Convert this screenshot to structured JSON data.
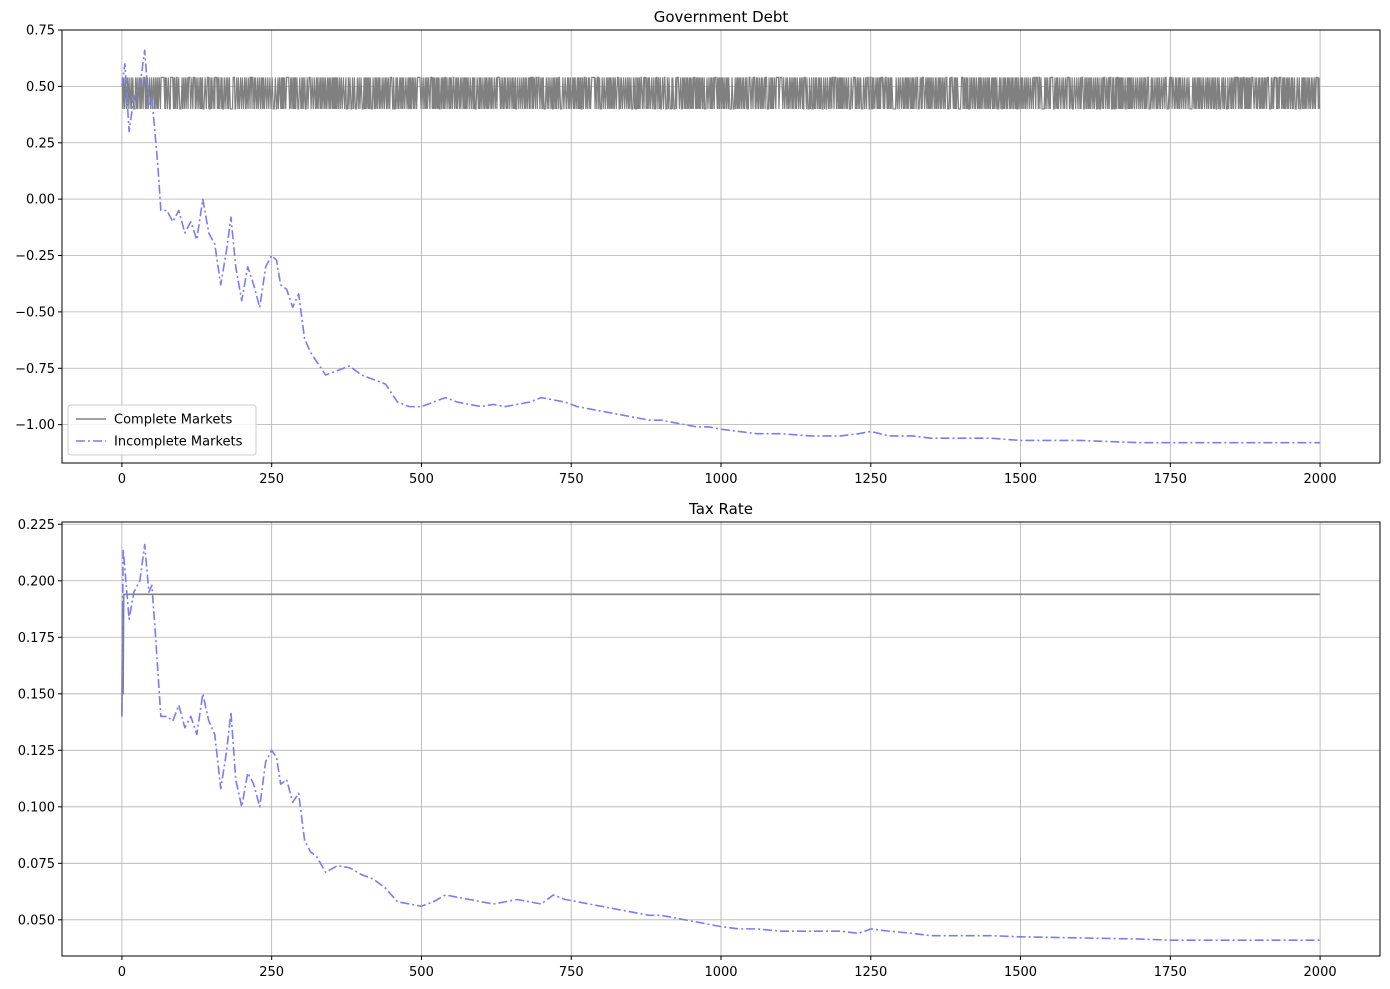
{
  "chart_data": [
    {
      "type": "line",
      "title": "Government Debt",
      "xlabel": "",
      "ylabel": "",
      "xlim": [
        -100,
        2100
      ],
      "ylim": [
        -1.17,
        0.75
      ],
      "xticks": [
        0,
        250,
        500,
        750,
        1000,
        1250,
        1500,
        1750,
        2000
      ],
      "xtick_labels": [
        "0",
        "250",
        "500",
        "750",
        "1000",
        "1250",
        "1500",
        "1750",
        "2000"
      ],
      "yticks": [
        0.75,
        0.5,
        0.25,
        0.0,
        -0.25,
        -0.5,
        -0.75,
        -1.0
      ],
      "ytick_labels": [
        "0.75",
        "0.50",
        "0.25",
        "0.00",
        "−0.25",
        "−0.50",
        "−0.75",
        "−1.00"
      ],
      "grid": true,
      "legend": "lower-left",
      "series": [
        {
          "name": "Complete Markets",
          "color": "#808080",
          "style": "solid",
          "oscillation": {
            "x_start": 0,
            "x_end": 2000,
            "high": 0.54,
            "low": 0.4
          },
          "x": [
            0,
            2000
          ],
          "y": [
            0.5,
            0.5
          ]
        },
        {
          "name": "Incomplete Markets",
          "color": "#7b7bf5",
          "style": "dashdot",
          "x": [
            0,
            5,
            12,
            20,
            30,
            38,
            45,
            50,
            55,
            60,
            65,
            75,
            85,
            95,
            105,
            115,
            125,
            135,
            145,
            155,
            165,
            175,
            182,
            190,
            200,
            210,
            220,
            230,
            240,
            250,
            258,
            265,
            275,
            285,
            295,
            305,
            315,
            325,
            340,
            360,
            380,
            400,
            420,
            440,
            460,
            480,
            500,
            520,
            540,
            560,
            580,
            600,
            620,
            640,
            660,
            680,
            700,
            720,
            740,
            760,
            780,
            800,
            820,
            840,
            860,
            880,
            900,
            920,
            940,
            960,
            980,
            1000,
            1030,
            1060,
            1100,
            1150,
            1200,
            1230,
            1250,
            1280,
            1320,
            1350,
            1400,
            1450,
            1500,
            1600,
            1700,
            1750,
            1800,
            1900,
            2000
          ],
          "y": [
            0.5,
            0.6,
            0.3,
            0.45,
            0.5,
            0.66,
            0.42,
            0.45,
            0.3,
            0.15,
            -0.05,
            -0.05,
            -0.1,
            -0.05,
            -0.15,
            -0.1,
            -0.18,
            0.0,
            -0.15,
            -0.2,
            -0.38,
            -0.22,
            -0.08,
            -0.3,
            -0.45,
            -0.3,
            -0.38,
            -0.48,
            -0.3,
            -0.25,
            -0.27,
            -0.38,
            -0.4,
            -0.48,
            -0.42,
            -0.62,
            -0.68,
            -0.72,
            -0.78,
            -0.76,
            -0.74,
            -0.78,
            -0.8,
            -0.82,
            -0.9,
            -0.92,
            -0.92,
            -0.9,
            -0.88,
            -0.9,
            -0.91,
            -0.92,
            -0.91,
            -0.92,
            -0.91,
            -0.9,
            -0.88,
            -0.89,
            -0.9,
            -0.92,
            -0.93,
            -0.94,
            -0.95,
            -0.96,
            -0.97,
            -0.98,
            -0.98,
            -0.99,
            -1.0,
            -1.01,
            -1.01,
            -1.02,
            -1.03,
            -1.04,
            -1.04,
            -1.05,
            -1.05,
            -1.04,
            -1.03,
            -1.05,
            -1.05,
            -1.06,
            -1.06,
            -1.06,
            -1.07,
            -1.07,
            -1.08,
            -1.08,
            -1.08,
            -1.08,
            -1.08
          ]
        }
      ]
    },
    {
      "type": "line",
      "title": "Tax Rate",
      "xlabel": "",
      "ylabel": "",
      "xlim": [
        -100,
        2100
      ],
      "ylim": [
        0.034,
        0.226
      ],
      "xticks": [
        0,
        250,
        500,
        750,
        1000,
        1250,
        1500,
        1750,
        2000
      ],
      "xtick_labels": [
        "0",
        "250",
        "500",
        "750",
        "1000",
        "1250",
        "1500",
        "1750",
        "2000"
      ],
      "yticks": [
        0.225,
        0.2,
        0.175,
        0.15,
        0.125,
        0.1,
        0.075,
        0.05
      ],
      "ytick_labels": [
        "0.225",
        "0.200",
        "0.175",
        "0.150",
        "0.125",
        "0.100",
        "0.075",
        "0.050"
      ],
      "grid": true,
      "legend": "none",
      "series": [
        {
          "name": "Complete Markets",
          "color": "#808080",
          "style": "solid",
          "x": [
            0,
            1,
            2,
            3,
            4,
            2000
          ],
          "y": [
            0.14,
            0.19,
            0.15,
            0.194,
            0.194,
            0.194
          ]
        },
        {
          "name": "Incomplete Markets",
          "color": "#7b7bf5",
          "style": "dashdot",
          "x": [
            0,
            2,
            5,
            12,
            20,
            30,
            38,
            45,
            50,
            55,
            60,
            65,
            75,
            85,
            95,
            105,
            115,
            125,
            135,
            145,
            155,
            165,
            175,
            182,
            190,
            200,
            210,
            220,
            230,
            240,
            250,
            258,
            265,
            275,
            285,
            295,
            305,
            315,
            325,
            340,
            360,
            380,
            400,
            420,
            440,
            460,
            480,
            500,
            520,
            540,
            560,
            580,
            600,
            620,
            640,
            660,
            680,
            700,
            720,
            740,
            760,
            780,
            800,
            820,
            840,
            860,
            880,
            900,
            920,
            940,
            960,
            980,
            1000,
            1030,
            1060,
            1100,
            1150,
            1200,
            1230,
            1250,
            1280,
            1320,
            1350,
            1400,
            1450,
            1500,
            1600,
            1700,
            1750,
            1800,
            1900,
            2000
          ],
          "y": [
            0.142,
            0.214,
            0.205,
            0.183,
            0.195,
            0.2,
            0.216,
            0.195,
            0.198,
            0.18,
            0.16,
            0.14,
            0.14,
            0.138,
            0.145,
            0.135,
            0.14,
            0.132,
            0.15,
            0.138,
            0.132,
            0.108,
            0.125,
            0.142,
            0.112,
            0.1,
            0.115,
            0.11,
            0.1,
            0.12,
            0.125,
            0.122,
            0.11,
            0.112,
            0.102,
            0.106,
            0.085,
            0.08,
            0.078,
            0.071,
            0.074,
            0.073,
            0.07,
            0.068,
            0.064,
            0.058,
            0.057,
            0.056,
            0.058,
            0.061,
            0.06,
            0.059,
            0.058,
            0.057,
            0.058,
            0.059,
            0.058,
            0.057,
            0.061,
            0.059,
            0.058,
            0.057,
            0.056,
            0.055,
            0.054,
            0.053,
            0.052,
            0.052,
            0.051,
            0.05,
            0.049,
            0.048,
            0.047,
            0.046,
            0.046,
            0.045,
            0.045,
            0.045,
            0.044,
            0.046,
            0.045,
            0.044,
            0.043,
            0.043,
            0.043,
            0.0425,
            0.042,
            0.0415,
            0.041,
            0.041,
            0.041,
            0.041
          ]
        }
      ]
    }
  ]
}
